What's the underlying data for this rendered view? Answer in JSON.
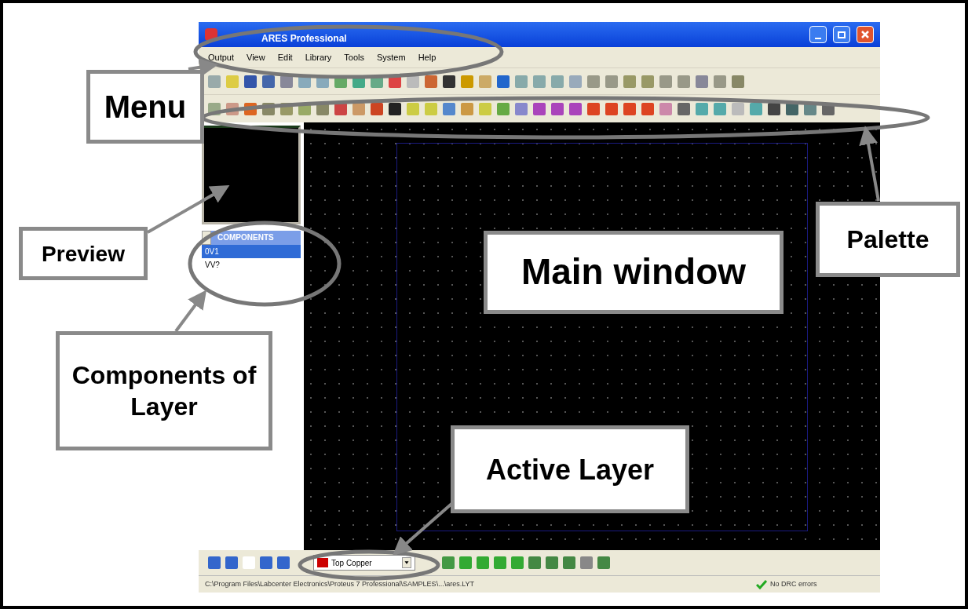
{
  "window": {
    "title": "ARES Professional"
  },
  "menu": [
    "Output",
    "View",
    "Edit",
    "Library",
    "Tools",
    "System",
    "Help"
  ],
  "sidebar": {
    "list_title": "COMPONENTS",
    "items": [
      {
        "label": "0V1",
        "selected": true
      },
      {
        "label": "VV?",
        "selected": false
      }
    ]
  },
  "layer_selector": {
    "value": "Top Copper",
    "color": "#cc0000"
  },
  "status_bar": {
    "path": "C:\\Program Files\\Labcenter Electronics\\Proteus 7 Professional\\SAMPLES\\...\\ares.LYT",
    "drc": "No DRC errors"
  },
  "annotations": [
    "Menu",
    "Preview",
    "Palette",
    "Main window",
    "Components of Layer",
    "Active Layer"
  ]
}
